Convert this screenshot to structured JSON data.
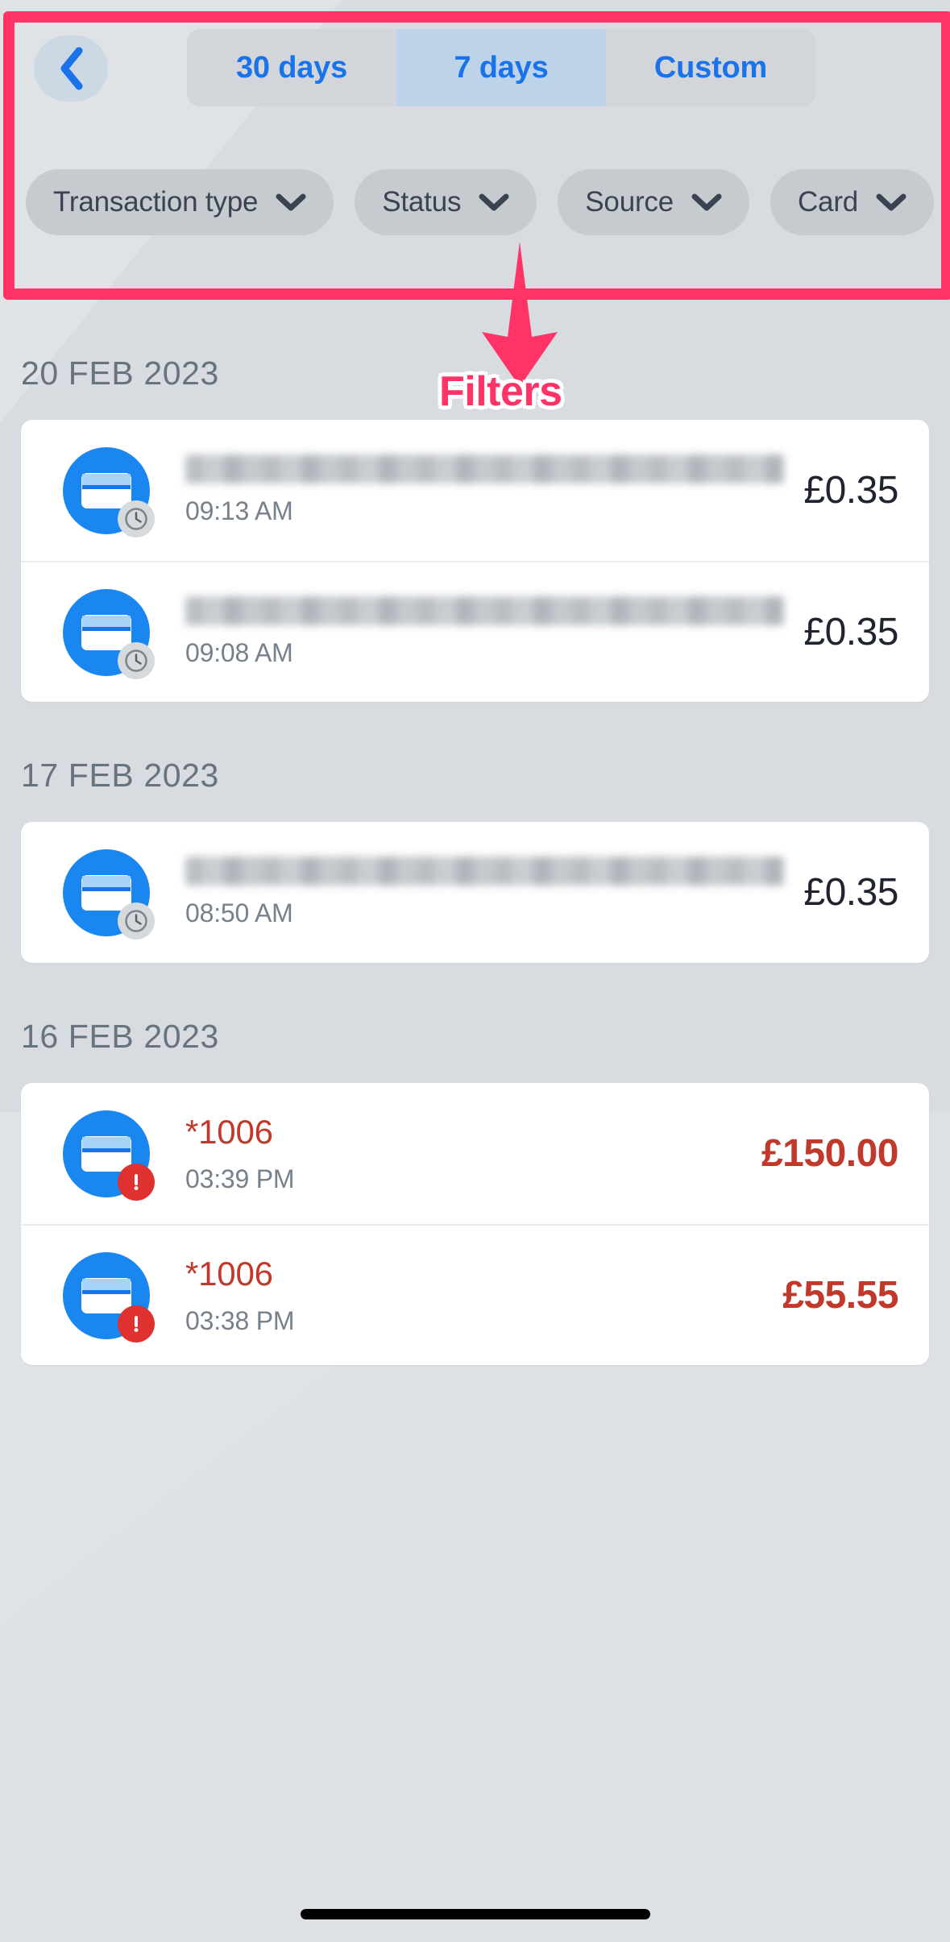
{
  "header": {
    "back_icon": "chevron-left-icon",
    "period_tabs": [
      {
        "label": "30 days",
        "active": false
      },
      {
        "label": "7 days",
        "active": true
      },
      {
        "label": "Custom",
        "active": false
      }
    ],
    "filter_chips": [
      {
        "label": "Transaction type",
        "icon": "chevron-down-icon"
      },
      {
        "label": "Status",
        "icon": "chevron-down-icon"
      },
      {
        "label": "Source",
        "icon": "chevron-down-icon"
      },
      {
        "label": "Card",
        "icon": "chevron-down-icon"
      }
    ]
  },
  "annotation": {
    "label": "Filters",
    "color": "#ff3366",
    "arrow_icon": "down-arrow-icon"
  },
  "colors": {
    "accent_blue": "#1a73e8",
    "card_icon_blue": "#1a86f0",
    "failed_red": "#c0392b",
    "badge_red": "#e03131",
    "annotation_pink": "#ff3366",
    "page_background": "#dfe3e6"
  },
  "groups": [
    {
      "date": "20 FEB 2023",
      "transactions": [
        {
          "title": null,
          "title_masked": true,
          "time": "09:13 AM",
          "amount": "£0.35",
          "status": "pending",
          "badge_icon": "clock-icon",
          "icon": "credit-card-icon"
        },
        {
          "title": null,
          "title_masked": true,
          "time": "09:08 AM",
          "amount": "£0.35",
          "status": "pending",
          "badge_icon": "clock-icon",
          "icon": "credit-card-icon"
        }
      ]
    },
    {
      "date": "17 FEB 2023",
      "transactions": [
        {
          "title": null,
          "title_masked": true,
          "time": "08:50 AM",
          "amount": "£0.35",
          "status": "pending",
          "badge_icon": "clock-icon",
          "icon": "credit-card-icon"
        }
      ]
    },
    {
      "date": "16 FEB 2023",
      "transactions": [
        {
          "title": "*1006",
          "title_masked": false,
          "time": "03:39 PM",
          "amount": "£150.00",
          "status": "failed",
          "badge_icon": "exclamation-icon",
          "icon": "credit-card-icon"
        },
        {
          "title": "*1006",
          "title_masked": false,
          "time": "03:38 PM",
          "amount": "£55.55",
          "status": "failed",
          "badge_icon": "exclamation-icon",
          "icon": "credit-card-icon"
        }
      ]
    }
  ]
}
